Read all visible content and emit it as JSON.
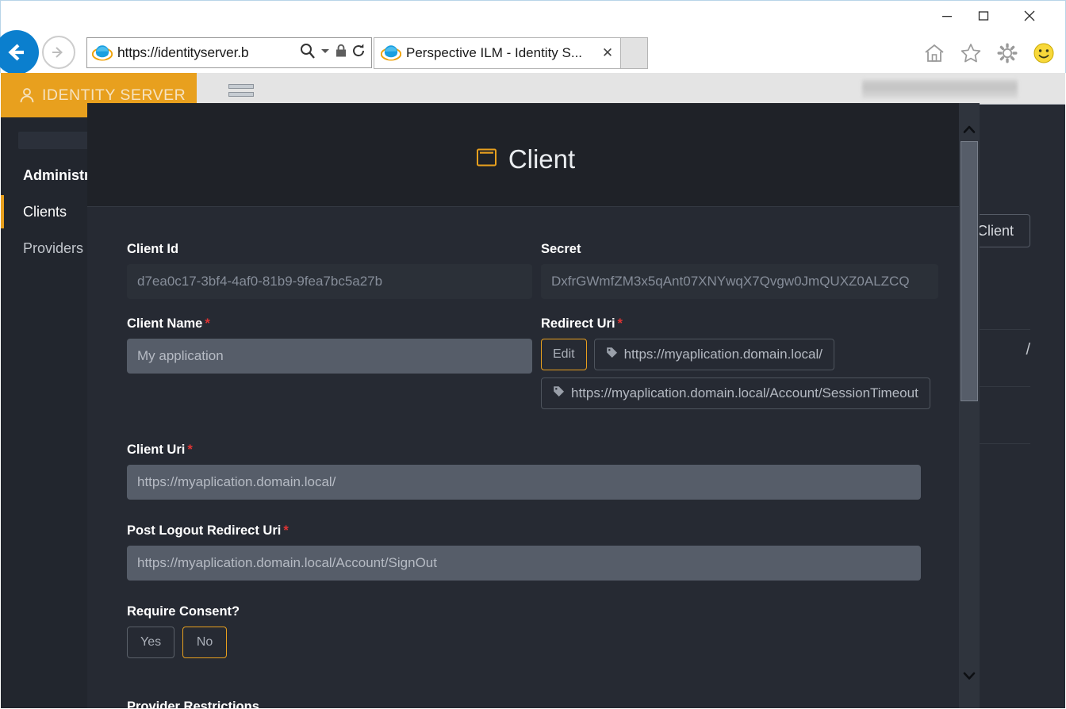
{
  "browser": {
    "window_controls": {
      "minimize": "—",
      "maximize": "☐",
      "close": "✕"
    },
    "back_label": "Back",
    "forward_label": "Forward",
    "address_url": "https://identityserver.b",
    "search_icon": "search-icon",
    "dropdown_icon": "chevron-down-icon",
    "lock_icon": "lock-icon",
    "refresh_icon": "refresh-icon",
    "tab": {
      "title": "Perspective ILM - Identity S...",
      "close": "✕"
    },
    "new_tab_label": "",
    "toolbar_icons": [
      "home-icon",
      "favorites-star-icon",
      "settings-gear-icon",
      "feedback-smiley-icon"
    ]
  },
  "sidebar": {
    "brand": "IDENTITY SERVER",
    "brand_icon": "user-icon",
    "items": [
      {
        "label": "Administration",
        "state": "head"
      },
      {
        "label": "Clients",
        "state": "active"
      },
      {
        "label": "Providers",
        "state": "plain"
      }
    ]
  },
  "background": {
    "client_button": "Client",
    "snippet": "/"
  },
  "modal": {
    "title": "Client",
    "title_icon": "window-icon",
    "fields": {
      "client_id": {
        "label": "Client Id",
        "value": "d7ea0c17-3bf4-4af0-81b9-9fea7bc5a27b",
        "required": false
      },
      "secret": {
        "label": "Secret",
        "value": "DxfrGWmfZM3x5qAnt07XNYwqX7Qvgw0JmQUXZ0ALZCQ",
        "required": false
      },
      "client_name": {
        "label": "Client Name",
        "placeholder": "My application",
        "required": true
      },
      "redirect_uri": {
        "label": "Redirect Uri",
        "required": true,
        "edit_label": "Edit",
        "tags": [
          "https://myaplication.domain.local/",
          "https://myaplication.domain.local/Account/SessionTimeout"
        ]
      },
      "client_uri": {
        "label": "Client Uri",
        "placeholder": "https://myaplication.domain.local/",
        "required": true
      },
      "post_logout_redirect_uri": {
        "label": "Post Logout Redirect Uri",
        "placeholder": "https://myaplication.domain.local/Account/SignOut",
        "required": true
      },
      "require_consent": {
        "label": "Require Consent?",
        "options": [
          {
            "label": "Yes",
            "selected": false
          },
          {
            "label": "No",
            "selected": true
          }
        ]
      },
      "provider_restrictions": {
        "label": "Provider Restrictions"
      }
    },
    "required_marker": "*",
    "scrollbar": {
      "up": "⌃",
      "down": "⌄"
    }
  },
  "colors": {
    "brand_amber": "#e8a01e",
    "page_bg": "#262a33",
    "sidebar_bg": "#22262e",
    "modal_header_bg": "#1f2228",
    "input_disabled_bg": "#2b3038",
    "input_editable_bg": "#565d69",
    "required_red": "#e03434",
    "browser_blue": "#0b7fce"
  }
}
